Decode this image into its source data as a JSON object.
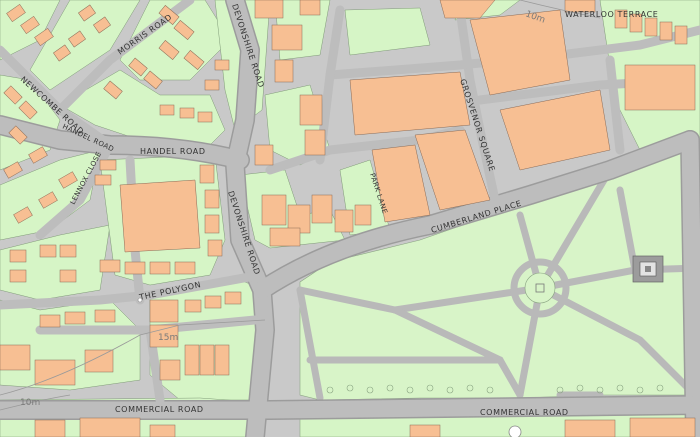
{
  "map": {
    "labels": {
      "waterloo_terrace": "WATERLOO TERRACE",
      "morris_road": "MORRIS ROAD",
      "devonshire_road_n": "DEVONSHIRE ROAD",
      "devonshire_road_s": "DEVONSHIRE ROAD",
      "newcombe_road": "NEWCOMBE ROAD",
      "handel_road_w": "HANDEL ROAD",
      "handel_road": "HANDEL ROAD",
      "lennox_close": "LENNOX CLOSE",
      "grosvenor_square": "GROSVENOR SQUARE",
      "park_lane": "PARK LANE",
      "cumberland_place": "CUMBERLAND PLACE",
      "the_polygon": "THE POLYGON",
      "commercial_road_w": "COMMERCIAL ROAD",
      "commercial_road_e": "COMMERCIAL ROAD"
    },
    "contours": {
      "c15": "15m",
      "c10": "10m",
      "c10b": "10m"
    },
    "colors": {
      "background": "#c9c9c9",
      "road": "#bdbdbd",
      "building": "#f7bf93",
      "plot": "#d6f5c6",
      "park": "#d8f4c8"
    }
  }
}
